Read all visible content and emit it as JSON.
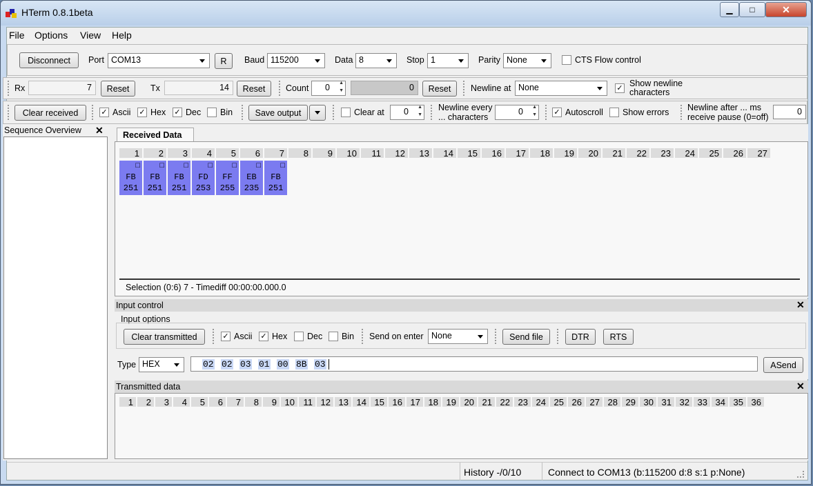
{
  "window": {
    "title": "HTerm 0.8.1beta",
    "min_symbol": "▁",
    "max_symbol": "□",
    "close_symbol": "✕"
  },
  "menu": [
    "File",
    "Options",
    "View",
    "Help"
  ],
  "connection": {
    "disconnect": "Disconnect",
    "port_label": "Port",
    "port_value": "COM13",
    "refresh": "R",
    "baud_label": "Baud",
    "baud_value": "115200",
    "data_label": "Data",
    "data_value": "8",
    "stop_label": "Stop",
    "stop_value": "1",
    "parity_label": "Parity",
    "parity_value": "None",
    "cts_label": "CTS Flow control"
  },
  "counters": {
    "rx_label": "Rx",
    "rx_value": "7",
    "rx_reset": "Reset",
    "tx_label": "Tx",
    "tx_value": "14",
    "tx_reset": "Reset",
    "count_label": "Count",
    "count_value": "0",
    "count_display": "0",
    "count_reset": "Reset",
    "newline_label": "Newline at",
    "newline_value": "None",
    "show_newline_1": "Show newline",
    "show_newline_2": "characters"
  },
  "receive_opts": {
    "clear_received": "Clear received",
    "ascii": "Ascii",
    "hex": "Hex",
    "dec": "Dec",
    "bin": "Bin",
    "save_output": "Save output",
    "clear_at": "Clear at",
    "clear_at_value": "0",
    "newline_every_1": "Newline every",
    "newline_every_2": "... characters",
    "newline_every_value": "0",
    "autoscroll": "Autoscroll",
    "show_errors": "Show errors",
    "newline_after_1": "Newline after ... ms",
    "newline_after_2": "receive pause (0=off)",
    "newline_after_value": "0",
    "check": "✓"
  },
  "sequence": {
    "title": "Sequence Overview",
    "close": "✕"
  },
  "received": {
    "tab": "Received Data",
    "columns": [
      "1",
      "2",
      "3",
      "4",
      "5",
      "6",
      "7",
      "8",
      "9",
      "10",
      "11",
      "12",
      "13",
      "14",
      "15",
      "16",
      "17",
      "18",
      "19",
      "20",
      "21",
      "22",
      "23",
      "24",
      "25",
      "26",
      "27"
    ],
    "bytes": [
      {
        "ascii": "□",
        "hex": "FB",
        "dec": "251"
      },
      {
        "ascii": "□",
        "hex": "FB",
        "dec": "251"
      },
      {
        "ascii": "□",
        "hex": "FB",
        "dec": "251"
      },
      {
        "ascii": "□",
        "hex": "FD",
        "dec": "253"
      },
      {
        "ascii": "□",
        "hex": "FF",
        "dec": "255"
      },
      {
        "ascii": "□",
        "hex": "EB",
        "dec": "235"
      },
      {
        "ascii": "□",
        "hex": "FB",
        "dec": "251"
      }
    ],
    "selection": "Selection (0:6) 7  -  Timediff 00:00:00.000.0"
  },
  "input": {
    "title": "Input control",
    "close": "✕",
    "options_label": "Input options",
    "clear_transmitted": "Clear transmitted",
    "ascii": "Ascii",
    "hex": "Hex",
    "dec": "Dec",
    "bin": "Bin",
    "send_on_enter_label": "Send on enter",
    "send_on_enter_value": "None",
    "send_file": "Send file",
    "dtr": "DTR",
    "rts": "RTS",
    "type_label": "Type",
    "type_value": "HEX",
    "hex_bytes": [
      "02",
      "02",
      "03",
      "01",
      "00",
      "8B",
      "03"
    ],
    "asend": "ASend"
  },
  "transmitted": {
    "title": "Transmitted data",
    "close": "✕",
    "columns": [
      "1",
      "2",
      "3",
      "4",
      "5",
      "6",
      "7",
      "8",
      "9",
      "10",
      "11",
      "12",
      "13",
      "14",
      "15",
      "16",
      "17",
      "18",
      "19",
      "20",
      "21",
      "22",
      "23",
      "24",
      "25",
      "26",
      "27",
      "28",
      "29",
      "30",
      "31",
      "32",
      "33",
      "34",
      "35",
      "36"
    ]
  },
  "status": {
    "history": "History -/0/10",
    "connection": "Connect to COM13 (b:115200 d:8 s:1 p:None)"
  }
}
